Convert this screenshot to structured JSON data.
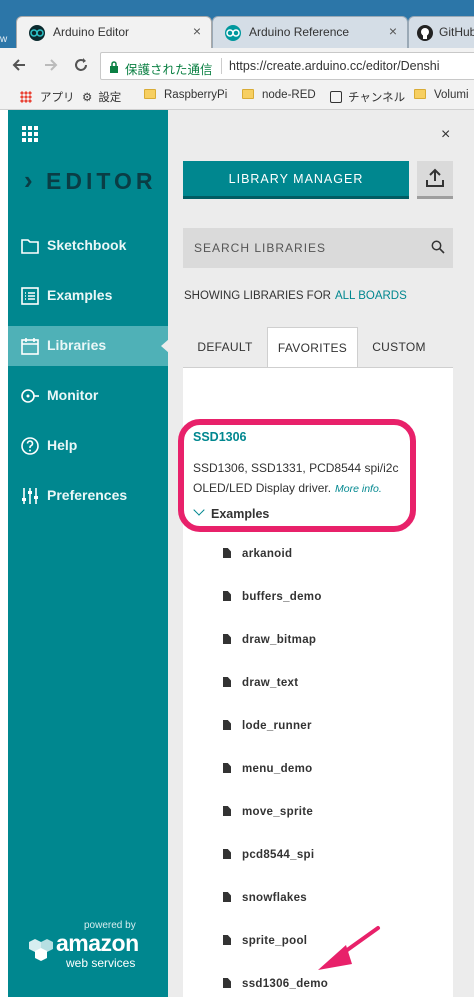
{
  "browser": {
    "tabs": [
      {
        "title": "Arduino Editor",
        "close": "×"
      },
      {
        "title": "Arduino Reference",
        "close": "×"
      },
      {
        "title": "GitHub",
        "close": ""
      }
    ],
    "left_edge_char": "w",
    "address": {
      "secure_label": "保護された通信",
      "url": "https://create.arduino.cc/editor/Denshi"
    },
    "bookmarks": [
      {
        "label": "アプリ"
      },
      {
        "label": "設定"
      },
      {
        "label": "RaspberryPi"
      },
      {
        "label": "node-RED"
      },
      {
        "label": "チャンネル"
      },
      {
        "label": "Volumi"
      }
    ]
  },
  "nav": {
    "logo_text": "EDITOR",
    "items": [
      {
        "label": "Sketchbook"
      },
      {
        "label": "Examples"
      },
      {
        "label": "Libraries"
      },
      {
        "label": "Monitor"
      },
      {
        "label": "Help"
      },
      {
        "label": "Preferences"
      }
    ],
    "aws": {
      "powered": "powered by",
      "amazon": "amazon",
      "ws": "web services"
    }
  },
  "panel": {
    "close": "×",
    "library_manager": "LIBRARY MANAGER",
    "search_placeholder": "SEARCH LIBRARIES",
    "showing_label": "SHOWING LIBRARIES FOR",
    "boards_link": "ALL BOARDS",
    "tabs": [
      {
        "label": "DEFAULT"
      },
      {
        "label": "FAVORITES"
      },
      {
        "label": "CUSTOM"
      }
    ],
    "library": {
      "name": "SSD1306",
      "description": "SSD1306, SSD1331, PCD8544 spi/i2c OLED/LED Display driver.",
      "more_info": "More info.",
      "examples_label": "Examples",
      "examples": [
        "arkanoid",
        "buffers_demo",
        "draw_bitmap",
        "draw_text",
        "lode_runner",
        "menu_demo",
        "move_sprite",
        "pcd8544_spi",
        "snowflakes",
        "sprite_pool",
        "ssd1306_demo"
      ]
    }
  },
  "colors": {
    "teal": "#00878f",
    "teal_active": "#4fb1b7",
    "highlight": "#e8216a"
  }
}
